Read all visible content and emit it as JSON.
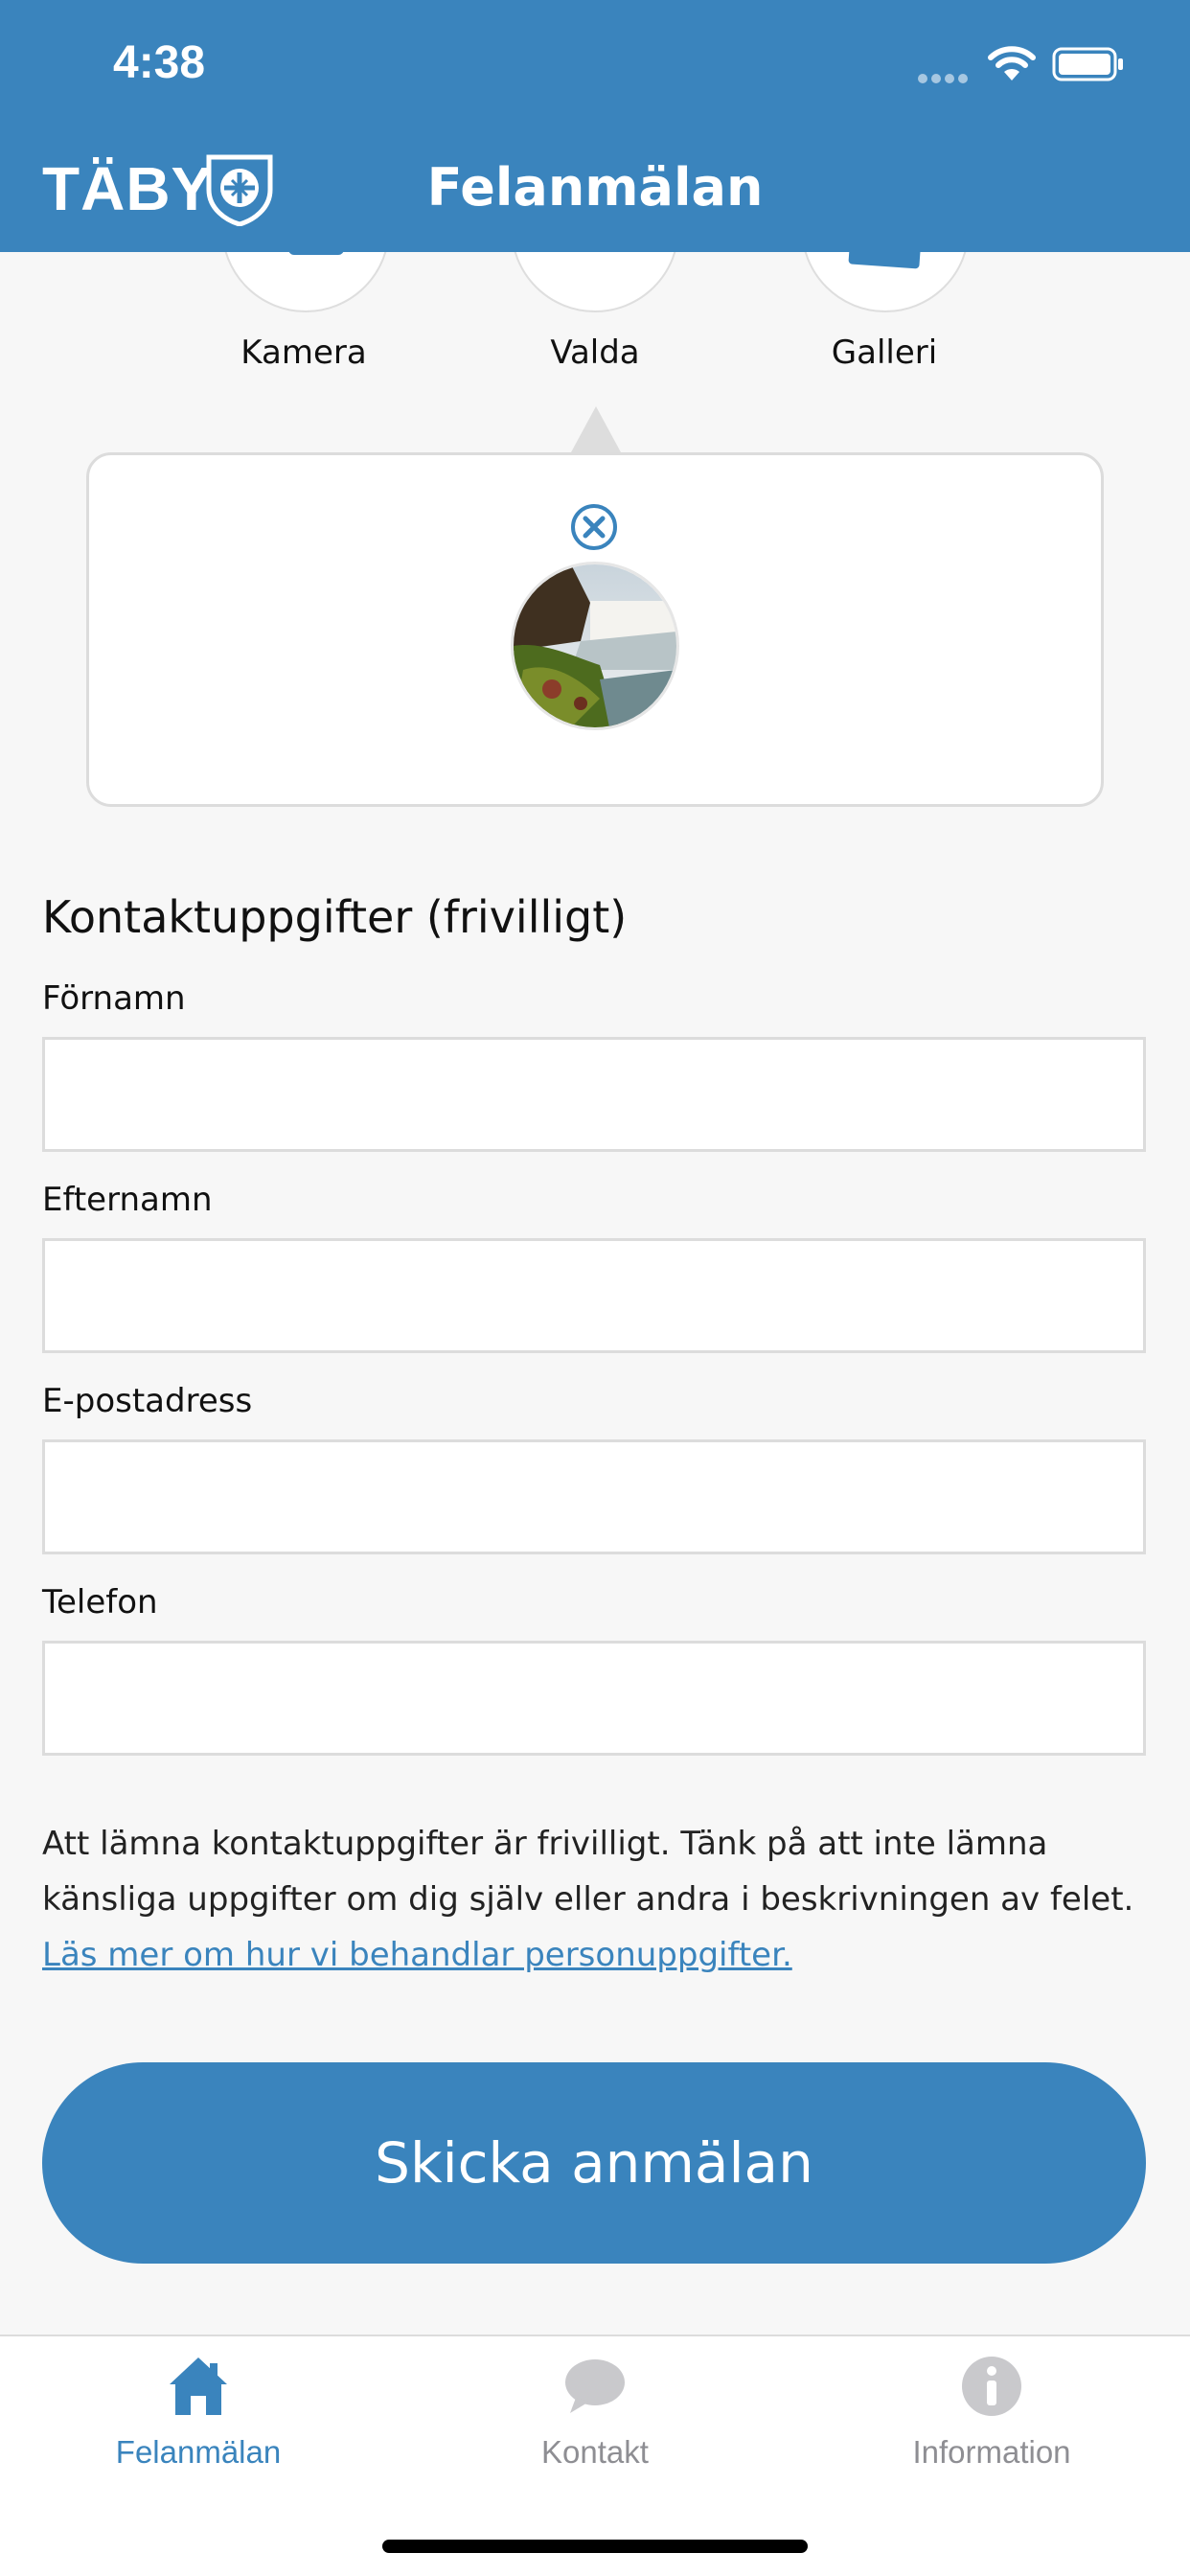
{
  "status_bar": {
    "time": "4:38"
  },
  "header": {
    "logo_text": "TÄBY",
    "title": "Felanmälan"
  },
  "media_sources": [
    {
      "label": "Kamera",
      "icon": "camera-icon"
    },
    {
      "label": "Valda",
      "icon": "selected-icon"
    },
    {
      "label": "Galleri",
      "icon": "gallery-icon"
    }
  ],
  "selected_media": {
    "thumbnail": "waterfall-photo",
    "remove_icon": "close-circle-icon"
  },
  "contact": {
    "section_title": "Kontaktuppgifter (frivilligt)",
    "fields": [
      {
        "label": "Förnamn",
        "value": ""
      },
      {
        "label": "Efternamn",
        "value": ""
      },
      {
        "label": "E-postadress",
        "value": ""
      },
      {
        "label": "Telefon",
        "value": ""
      }
    ],
    "notice": "Att lämna kontaktuppgifter är frivilligt. Tänk på att inte lämna känsliga uppgifter om dig själv eller andra i beskrivningen av felet.",
    "link_text": "Läs mer om hur vi behandlar personuppgifter."
  },
  "submit_label": "Skicka anmälan",
  "tabbar": {
    "items": [
      {
        "label": "Felanmälan",
        "icon": "home-icon",
        "active": true
      },
      {
        "label": "Kontakt",
        "icon": "chat-bubble-icon",
        "active": false
      },
      {
        "label": "Information",
        "icon": "info-icon",
        "active": false
      }
    ]
  },
  "colors": {
    "brand": "#3a84bd",
    "inactive": "#8e8e93",
    "background": "#f7f7f7"
  }
}
